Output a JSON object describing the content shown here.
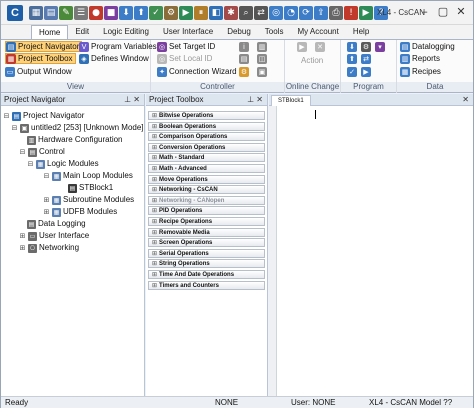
{
  "app": {
    "title": "XL4 - CsCAN",
    "logo_letter": "C"
  },
  "quick_access_icons": [
    {
      "name": "save-icon",
      "glyph": "▦",
      "color": "#4a6d9c"
    },
    {
      "name": "open-icon",
      "glyph": "▤",
      "color": "#5a7bb0"
    },
    {
      "name": "connect-icon",
      "glyph": "✎",
      "color": "#4c8a3b"
    },
    {
      "name": "properties-icon",
      "glyph": "☰",
      "color": "#7a7a7a"
    },
    {
      "name": "record-icon",
      "glyph": "●",
      "color": "#c0392b"
    },
    {
      "name": "stop-icon",
      "glyph": "■",
      "color": "#7b3fa0"
    },
    {
      "name": "download-icon",
      "glyph": "⬇",
      "color": "#3d7dc8"
    },
    {
      "name": "upload-icon",
      "glyph": "⬆",
      "color": "#3d7dc8"
    },
    {
      "name": "verify-icon",
      "glyph": "✓",
      "color": "#3f8f52"
    },
    {
      "name": "compile-icon",
      "glyph": "⚙",
      "color": "#8a6d3b"
    },
    {
      "name": "run-icon",
      "glyph": "▶",
      "color": "#2e8b57"
    },
    {
      "name": "pause-icon",
      "glyph": "⏸",
      "color": "#b07d2b"
    },
    {
      "name": "monitor-icon",
      "glyph": "◧",
      "color": "#2f6fb5"
    },
    {
      "name": "debug-icon",
      "glyph": "✱",
      "color": "#a34b4b"
    },
    {
      "name": "find-icon",
      "glyph": "⌕",
      "color": "#555555"
    },
    {
      "name": "replace-icon",
      "glyph": "⇄",
      "color": "#555555"
    },
    {
      "name": "scan-icon",
      "glyph": "◎",
      "color": "#3d7dc8"
    },
    {
      "name": "timer-icon",
      "glyph": "◔",
      "color": "#3d7dc8"
    },
    {
      "name": "cycle-icon",
      "glyph": "⟳",
      "color": "#3d7dc8"
    },
    {
      "name": "export-icon",
      "glyph": "⇪",
      "color": "#3d7dc8"
    },
    {
      "name": "print-icon",
      "glyph": "⎙",
      "color": "#666666"
    },
    {
      "name": "alarm-icon",
      "glyph": "!",
      "color": "#c0392b"
    },
    {
      "name": "media-icon",
      "glyph": "▶",
      "color": "#2e8b57"
    },
    {
      "name": "help-icon",
      "glyph": "?",
      "color": "#3d7dc8"
    }
  ],
  "menu": {
    "tabs": [
      "Home",
      "Edit",
      "Logic Editing",
      "User Interface",
      "Debug",
      "Tools",
      "My Account",
      "Help"
    ]
  },
  "ribbon": {
    "view": {
      "label": "View",
      "project_navigator": "Project Navigator",
      "program_variables": "Program Variables",
      "project_toolbox": "Project Toolbox",
      "defines_window": "Defines Window",
      "output_window": "Output Window"
    },
    "controller": {
      "label": "Controller",
      "set_target_id": "Set Target",
      "set_target_suffix": "ID",
      "set_local_id": "Set Local",
      "set_local_suffix": "ID",
      "connection_wizard": "Connection Wizard"
    },
    "online_change": {
      "label": "Online Change",
      "action": "Action"
    },
    "program": {
      "label": "Program"
    },
    "data": {
      "label": "Data",
      "datalogging": "Datalogging",
      "reports": "Reports",
      "recipes": "Recipes"
    }
  },
  "project_navigator": {
    "header": "Project Navigator",
    "root": "Project Navigator",
    "project": "untitled2 [253] [Unknown Mode]",
    "hardware": "Hardware Configuration",
    "control": "Control",
    "logic_modules": "Logic Modules",
    "main_loop": "Main Loop Modules",
    "stblock": "STBlock1",
    "subroutine": "Subroutine Modules",
    "udfb": "UDFB Modules",
    "data_logging": "Data Logging",
    "user_interface": "User Interface",
    "networking": "Networking"
  },
  "project_toolbox": {
    "header": "Project Toolbox",
    "items": [
      "Bitwise Operations",
      "Boolean Operations",
      "Comparison Operations",
      "Conversion Operations",
      "Math - Standard",
      "Math - Advanced",
      "Move Operations",
      "Networking - CsCAN",
      "Networking - CANopen",
      "PID Operations",
      "Recipe Operations",
      "Removable Media",
      "Screen Operations",
      "Serial Operations",
      "String Operations",
      "Time And Date Operations",
      "Timers and Counters"
    ],
    "disabled_index": 8
  },
  "editor": {
    "tab": "STBlock1"
  },
  "status": {
    "ready": "Ready",
    "s1": "NONE",
    "s2": "User: NONE",
    "model": "XL4 - CsCAN Model ??"
  }
}
